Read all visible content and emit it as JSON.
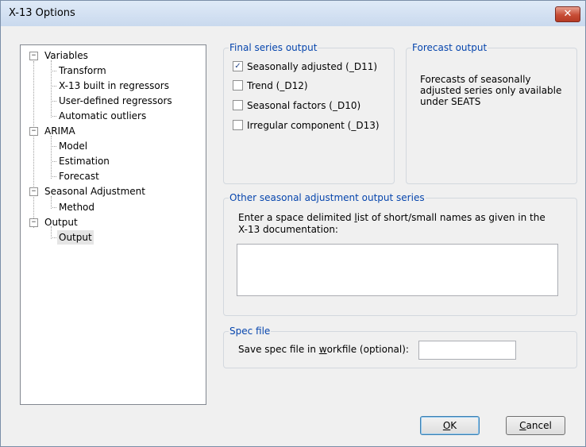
{
  "window": {
    "title": "X-13 Options",
    "close_glyph": "✕"
  },
  "tree": {
    "items": [
      {
        "label": "Variables",
        "level": 0,
        "expander": "−"
      },
      {
        "label": "Transform",
        "level": 1
      },
      {
        "label": "X-13 built in regressors",
        "level": 1
      },
      {
        "label": "User-defined regressors",
        "level": 1
      },
      {
        "label": "Automatic outliers",
        "level": 1
      },
      {
        "label": "ARIMA",
        "level": 0,
        "expander": "−"
      },
      {
        "label": "Model",
        "level": 1
      },
      {
        "label": "Estimation",
        "level": 1
      },
      {
        "label": "Forecast",
        "level": 1
      },
      {
        "label": "Seasonal Adjustment",
        "level": 0,
        "expander": "−"
      },
      {
        "label": "Method",
        "level": 1
      },
      {
        "label": "Output",
        "level": 0,
        "expander": "−"
      },
      {
        "label": "Output",
        "level": 1,
        "selected": true
      }
    ]
  },
  "final_series": {
    "legend": "Final series output",
    "checkboxes": [
      {
        "label": "Seasonally adjusted (_D11)",
        "checked": true
      },
      {
        "label": "Trend (_D12)",
        "checked": false
      },
      {
        "label": "Seasonal factors (_D10)",
        "checked": false
      },
      {
        "label": "Irregular component (_D13)",
        "checked": false
      }
    ]
  },
  "forecast_output": {
    "legend": "Forecast output",
    "text": "Forecasts of seasonally adjusted series only available under SEATS"
  },
  "other_series": {
    "legend": "Other seasonal adjustment output series",
    "instructions_pre": "Enter a space delimited ",
    "instructions_mnemonic": "l",
    "instructions_post": "ist of short/small names as given in the X-13 documentation:",
    "value": ""
  },
  "spec_file": {
    "legend": "Spec file",
    "label_pre": "Save spec file in ",
    "label_mnemonic": "w",
    "label_post": "orkfile (optional):",
    "value": ""
  },
  "buttons": {
    "ok_mnemonic": "O",
    "ok_rest": "K",
    "cancel_mnemonic": "C",
    "cancel_rest": "ancel"
  }
}
